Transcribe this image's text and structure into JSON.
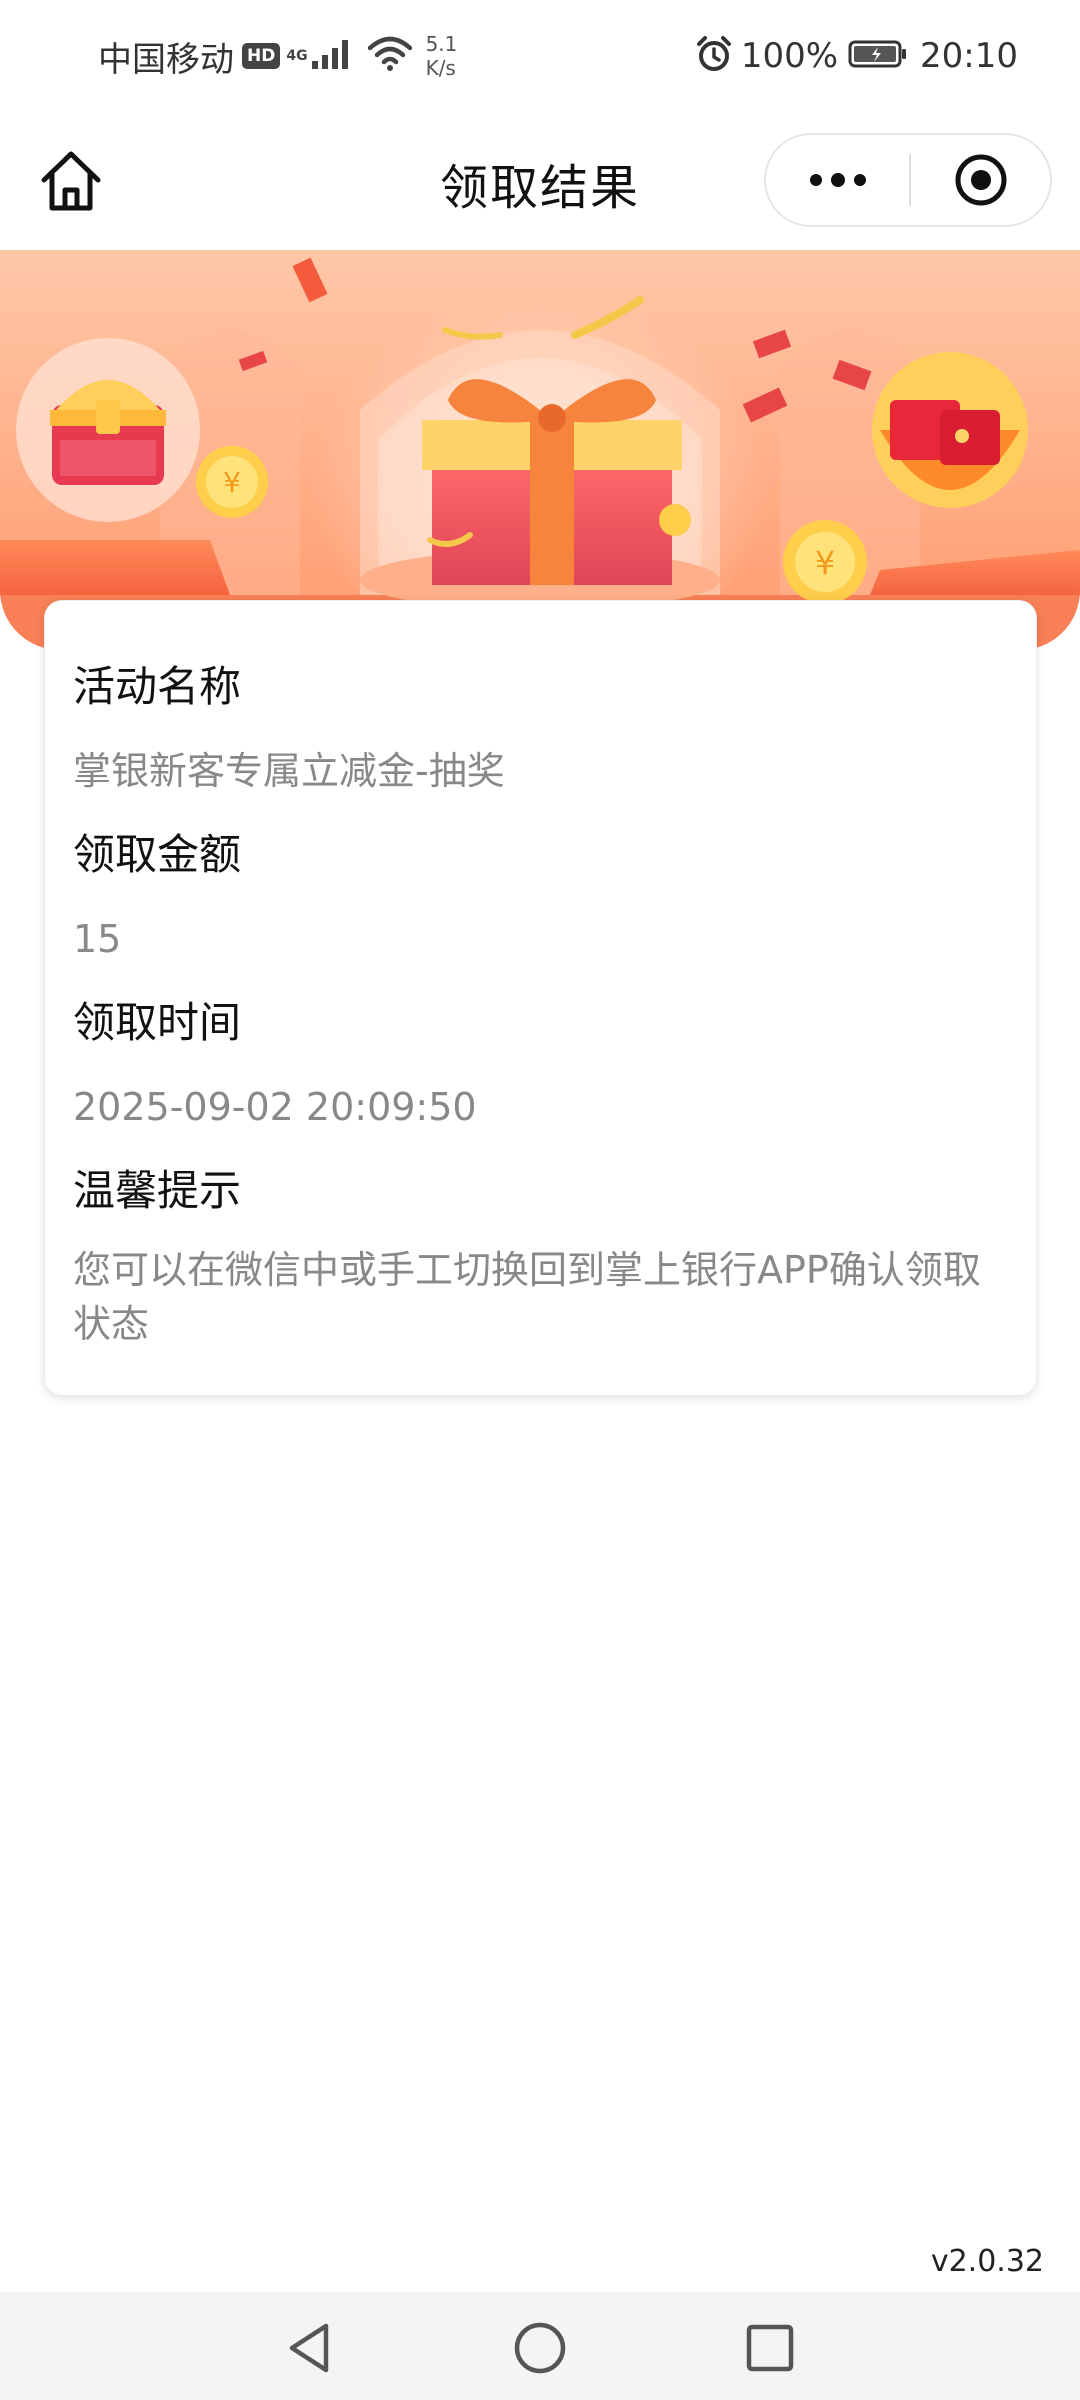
{
  "status_bar": {
    "carrier": "中国移动",
    "hd_badge": "HD",
    "network_type": "4G",
    "net_speed_value": "5.1",
    "net_speed_unit": "K/s",
    "battery_percent": "100%",
    "time": "20:10",
    "icons": [
      "signal-icon",
      "wifi-icon",
      "alarm-icon",
      "battery-icon"
    ]
  },
  "nav_bar": {
    "title": "领取结果",
    "icons": [
      "home-icon",
      "more-icon",
      "close-target-icon"
    ]
  },
  "card": {
    "fields": [
      {
        "label": "活动名称",
        "value": "掌银新客专属立减金-抽奖"
      },
      {
        "label": "领取金额",
        "value": "15"
      },
      {
        "label": "领取时间",
        "value": "2025-09-02 20:09:50"
      },
      {
        "label": "温馨提示",
        "value": "您可以在微信中或手工切换回到掌上银行APP确认领取状态"
      }
    ]
  },
  "version": "v2.0.32",
  "system_nav": {
    "icons": [
      "back-triangle-icon",
      "home-circle-icon",
      "recents-square-icon"
    ]
  },
  "colors": {
    "banner_light": "#ffd3b8",
    "banner_mid": "#ff9a6e",
    "banner_dark": "#f66a44",
    "gift_red": "#e8505b",
    "gift_ribbon": "#f6843c",
    "gift_lid": "#ffd36a",
    "label_text": "#111111",
    "value_text": "#888888"
  }
}
